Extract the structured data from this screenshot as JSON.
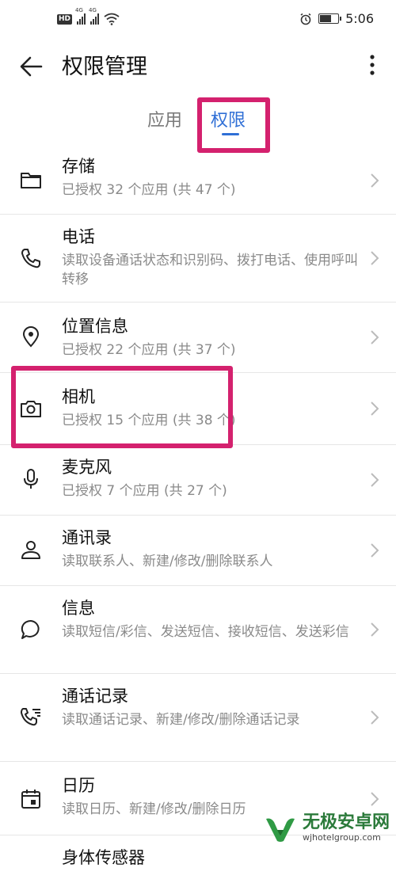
{
  "status_bar": {
    "hd_badge": "HD",
    "network_1": "4G",
    "network_2": "4G",
    "time": "5:06",
    "battery_level": 0.6
  },
  "header": {
    "title": "权限管理"
  },
  "tabs": [
    {
      "label": "应用",
      "active": false
    },
    {
      "label": "权限",
      "active": true
    }
  ],
  "permissions": [
    {
      "name": "存储",
      "desc": "已授权 32 个应用 (共 47 个)",
      "icon": "folder-icon"
    },
    {
      "name": "电话",
      "desc": "读取设备通话状态和识别码、拨打电话、使用呼叫转移",
      "icon": "phone-icon"
    },
    {
      "name": "位置信息",
      "desc": "已授权 22 个应用 (共 37 个)",
      "icon": "location-pin-icon"
    },
    {
      "name": "相机",
      "desc": "已授权 15 个应用 (共 38 个)",
      "icon": "camera-icon"
    },
    {
      "name": "麦克风",
      "desc": "已授权 7 个应用 (共 27 个)",
      "icon": "microphone-icon"
    },
    {
      "name": "通讯录",
      "desc": "读取联系人、新建/修改/删除联系人",
      "icon": "person-icon"
    },
    {
      "name": "信息",
      "desc": "读取短信/彩信、发送短信、接收短信、发送彩信",
      "icon": "chat-bubble-icon"
    },
    {
      "name": "通话记录",
      "desc": "读取通话记录、新建/修改/删除通话记录",
      "icon": "call-log-icon"
    },
    {
      "name": "日历",
      "desc": "读取日历、新建/修改/删除日历",
      "icon": "calendar-icon"
    },
    {
      "name": "身体传感器",
      "desc": "",
      "icon": "sensor-icon"
    }
  ],
  "colors": {
    "accent": "#2f6fd6",
    "highlight": "#d4216e"
  },
  "watermark": {
    "title": "无极安卓网",
    "url": "wjhotelgroup.com"
  }
}
